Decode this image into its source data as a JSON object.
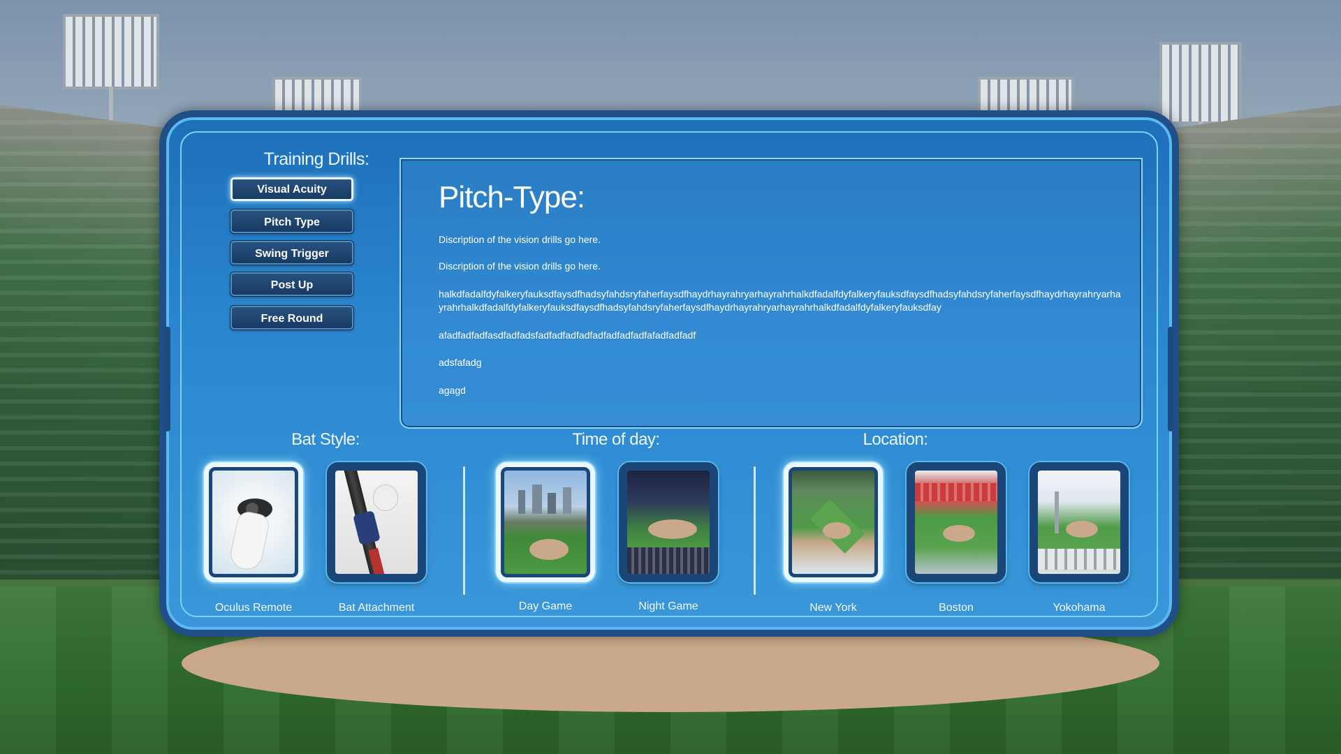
{
  "training_drills": {
    "title": "Training Drills:",
    "items": [
      {
        "label": "Visual Acuity",
        "active": true
      },
      {
        "label": "Pitch Type",
        "active": false
      },
      {
        "label": "Swing Trigger",
        "active": false
      },
      {
        "label": "Post Up",
        "active": false
      },
      {
        "label": "Free Round",
        "active": false
      }
    ]
  },
  "description": {
    "title": "Pitch-Type:",
    "lines": [
      "Discription of the vision drills go here.",
      "Discription of the vision drills go here.",
      "halkdfadalfdyfalkeryfauksdfaysdfhadsyfahdsryfaherfaysdfhaydrhayrahryarhayrahrhalkdfadalfdyfalkeryfauksdfaysdfhadsyfahdsryfaherfaysdfhaydrhayrahryarhayrahrhalkdfadalfdyfalkeryfauksdfaysdfhadsyfahdsryfaherfaysdfhaydrhayrahryarhayrahrhalkdfadalfdyfalkeryfauksdfay",
      "afadfadfadfasdfadfadsfadfadfadfadfadfadfadfadfafadfadfadf",
      "adsfafadg",
      "agagd"
    ]
  },
  "bat_style": {
    "title": "Bat Style:",
    "options": [
      {
        "label": "Oculus Remote",
        "selected": true,
        "icon": "oculus-controller-icon"
      },
      {
        "label": "Bat Attachment",
        "selected": false,
        "icon": "bat-attachment-icon"
      }
    ]
  },
  "time_of_day": {
    "title": "Time of day:",
    "options": [
      {
        "label": "Day Game",
        "selected": true
      },
      {
        "label": "Night Game",
        "selected": false
      }
    ]
  },
  "location": {
    "title": "Location:",
    "options": [
      {
        "label": "New York",
        "selected": true
      },
      {
        "label": "Boston",
        "selected": false
      },
      {
        "label": "Yokohama",
        "selected": false
      }
    ]
  },
  "colors": {
    "panel": "#2a86cf",
    "panel_border": "#1f4f86",
    "button": "#173a63",
    "highlight": "#e9f8ff"
  }
}
